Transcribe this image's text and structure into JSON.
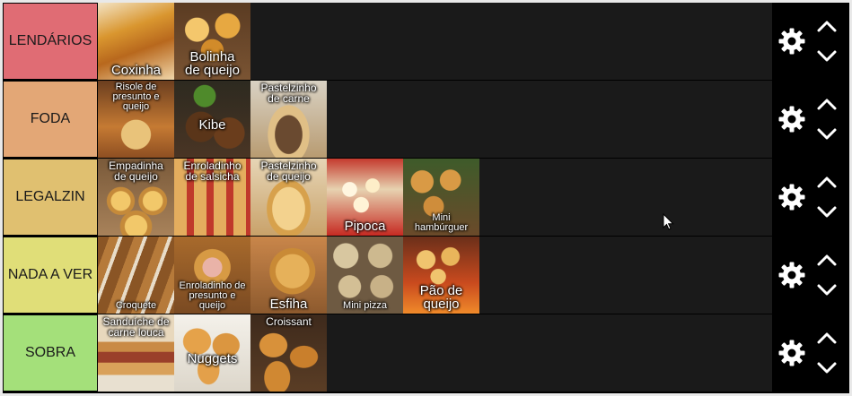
{
  "tiers": [
    {
      "label": "LENDÁRIOS",
      "color": "#e06c74",
      "items": [
        {
          "name": "Coxinha",
          "pos": "bottom",
          "bg": "linear-gradient(160deg,#f3e3c4 0%,#d9962f 35%,#b8681d 60%,#f0d6a9 100%)"
        },
        {
          "name": "Bolinha\nde queijo",
          "pos": "bottom",
          "bg": "radial-gradient(circle at 30% 35%,#f4c76c 0 16%,transparent 17%),radial-gradient(circle at 70% 30%,#e7a841 0 16%,transparent 17%),radial-gradient(circle at 50% 62%,#d18b2a 0 18%,transparent 19%),linear-gradient(180deg,#5a3b22,#7a5433)"
        }
      ]
    },
    {
      "label": "FODA",
      "color": "#e3a776",
      "items": [
        {
          "name": "Risole de\npresunto e\nqueijo",
          "pos": "top",
          "small": true,
          "bg": "radial-gradient(circle at 50% 70%,#e9c37a 0 22%,transparent 23%),linear-gradient(180deg,#6b3e1f,#c57a33 60%,#8e4f22)"
        },
        {
          "name": "Kibe",
          "pos": "mid",
          "bg": "radial-gradient(circle at 40% 20%,#4f8a2b 0 14%,transparent 15%),radial-gradient(circle at 35% 60%,#5a3519 0 22%,transparent 23%),radial-gradient(circle at 72% 68%,#6a3d1c 0 20%,transparent 21%),linear-gradient(180deg,#2d2a20,#4a3524)"
        },
        {
          "name": "Pastelzinho\nde carne",
          "pos": "top",
          "bg": "radial-gradient(ellipse at 50% 70%,#6a4a30 0 25%,#e0bf86 26% 38%,transparent 39%),linear-gradient(180deg,#d9d2c4,#b89b71)"
        }
      ]
    },
    {
      "label": "LEGALZIN",
      "color": "#e0c070",
      "items": [
        {
          "name": "Empadinha\nde queijo",
          "pos": "top",
          "bg": "radial-gradient(circle at 30% 55%,#f2c86a 0 14%,#c58a3a 15% 20%,transparent 21%),radial-gradient(circle at 72% 55%,#f2c86a 0 14%,#c58a3a 15% 20%,transparent 21%),radial-gradient(circle at 50% 88%,#f2c86a 0 14%,#c58a3a 15% 20%,transparent 21%),linear-gradient(180deg,#7a5a3a,#a8825a)"
        },
        {
          "name": "Enroladinho\nde salsicha",
          "pos": "top",
          "bg": "repeating-linear-gradient(90deg,#e4ad5e 0 14px,#c0392b 14px 22px),linear-gradient(#d9a05a,#d9a05a)"
        },
        {
          "name": "Pastelzinho\nde queijo",
          "pos": "top",
          "bg": "radial-gradient(ellipse at 50% 65%,#f3d28e 0 30%,#d7a14c 31% 40%,transparent 41%),linear-gradient(180deg,#e6d5b5,#c9a26a)"
        },
        {
          "name": "Pipoca",
          "pos": "bottom",
          "bg": "radial-gradient(circle at 30% 40%,#fff6e0 0 10%,transparent 11%),radial-gradient(circle at 60% 35%,#fdeec8 0 10%,transparent 11%),radial-gradient(circle at 45% 60%,#fff3d6 0 12%,transparent 13%),linear-gradient(180deg,#c43a2e,#e7d2b0 40%,#c62a22)"
        },
        {
          "name": "Mini\nhambúrguer",
          "pos": "bottom",
          "small": true,
          "bg": "radial-gradient(circle at 25% 30%,#d99a45 0 14%,transparent 15%),radial-gradient(circle at 62% 28%,#d99a45 0 14%,transparent 15%),radial-gradient(circle at 40% 62%,#cf8d3b 0 15%,transparent 16%),linear-gradient(180deg,#3e5b2a,#6b4a2a)"
        }
      ]
    },
    {
      "label": "NADA A VER",
      "color": "#e0de78",
      "items": [
        {
          "name": "Croquete",
          "pos": "bottom",
          "small": true,
          "bg": "repeating-linear-gradient(110deg,#8a5525 0 12px,#b67a3a 12px 22px,#e8dcc8 22px 26px)"
        },
        {
          "name": "Enroladinho de\npresunto e\nqueijo",
          "pos": "bottom",
          "small": true,
          "bg": "radial-gradient(circle at 50% 40%,#e9b3a8 0 16%,#d79a44 17% 30%,transparent 31%),linear-gradient(180deg,#a86a2c,#7a4a22)"
        },
        {
          "name": "Esfiha",
          "pos": "bottom",
          "bg": "radial-gradient(ellipse at 55% 45%,#e6b15a 0 28%,#c98a36 29% 38%,transparent 39%),linear-gradient(180deg,#c9864a,#8d5a2e)"
        },
        {
          "name": "Mini pizza",
          "pos": "bottom",
          "small": true,
          "bg": "radial-gradient(circle at 25% 25%,#d8c7a0 0 15%,transparent 16%),radial-gradient(circle at 70% 25%,#cdb98f 0 15%,transparent 16%),radial-gradient(circle at 30% 65%,#d3bf95 0 15%,transparent 16%),radial-gradient(circle at 72% 65%,#c8b187 0 15%,transparent 16%),linear-gradient(#6e5a42,#6e5a42)"
        },
        {
          "name": "Pão de\nqueijo",
          "pos": "bottom",
          "bg": "radial-gradient(circle at 30% 30%,#f0c46e 0 12%,transparent 13%),radial-gradient(circle at 62% 26%,#e9b55b 0 12%,transparent 13%),radial-gradient(circle at 46% 52%,#f0c46e 0 13%,transparent 14%),linear-gradient(180deg,#6b2f1a,#c94a1e 60%,#f08a2a)"
        }
      ]
    },
    {
      "label": "SOBRA",
      "color": "#a4e07a",
      "items": [
        {
          "name": "Sanduíche de\ncarne louca",
          "pos": "top",
          "bg": "linear-gradient(180deg,#e8d8bd 0 35%,#c98a45 36% 48%,#9a3f2a 49% 62%,#d9a15a 63% 78%,#e8e0d0 79%)"
        },
        {
          "name": "Nuggets",
          "pos": "mid",
          "bg": "radial-gradient(ellipse at 30% 35%,#e5a24a 0 18%,transparent 19%),radial-gradient(ellipse at 68% 40%,#db9640 0 18%,transparent 19%),radial-gradient(ellipse at 45% 72%,#e3a04a 0 18%,transparent 19%),linear-gradient(180deg,#f4f1ea,#dcd6ca)"
        },
        {
          "name": "Croissant",
          "pos": "top",
          "bg": "radial-gradient(ellipse at 30% 40%,#d8913a 0 18%,transparent 19%),radial-gradient(ellipse at 70% 55%,#c97f2c 0 18%,transparent 19%),radial-gradient(ellipse at 35% 82%,#d08832 0 18%,transparent 19%),linear-gradient(180deg,#3e2a1c,#5a3d25)"
        }
      ]
    }
  ],
  "icons": {
    "settings": "gear-icon",
    "move_up": "chevron-up-icon",
    "move_down": "chevron-down-icon"
  }
}
